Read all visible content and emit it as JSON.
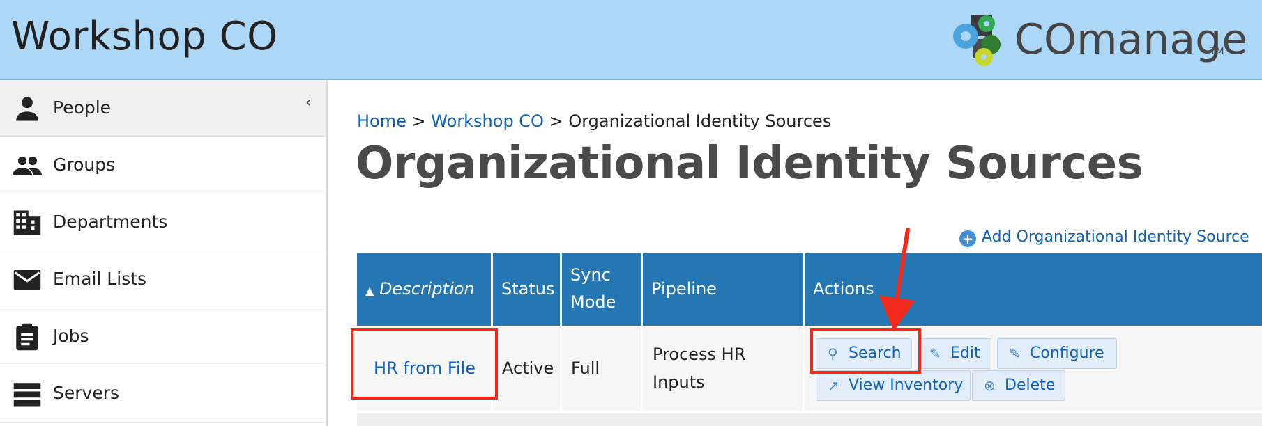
{
  "header": {
    "co_title": "Workshop CO",
    "logo_text": "COmanage",
    "logo_tm": "TM"
  },
  "sidebar": {
    "collapse_icon": "chevron-left-icon",
    "items": [
      {
        "label": "People",
        "icon": "person-icon",
        "active": true
      },
      {
        "label": "Groups",
        "icon": "group-icon"
      },
      {
        "label": "Departments",
        "icon": "building-icon"
      },
      {
        "label": "Email Lists",
        "icon": "email-icon"
      },
      {
        "label": "Jobs",
        "icon": "clipboard-icon"
      },
      {
        "label": "Servers",
        "icon": "servers-icon"
      }
    ]
  },
  "breadcrumb": {
    "home": "Home",
    "sep": ">",
    "co": "Workshop CO",
    "current": "Organizational Identity Sources"
  },
  "page": {
    "title": "Organizational Identity Sources",
    "add_link": "Add Organizational Identity Source"
  },
  "table": {
    "columns": {
      "sort_indicator": "▲",
      "description": "Description",
      "status": "Status",
      "sync_mode_line1": "Sync",
      "sync_mode_line2": "Mode",
      "pipeline": "Pipeline",
      "actions": "Actions"
    },
    "rows": [
      {
        "description": "HR from File",
        "status": "Active",
        "sync_mode": "Full",
        "pipeline_line1": "Process HR",
        "pipeline_line2": "Inputs",
        "actions": {
          "search": "Search",
          "edit": "Edit",
          "configure": "Configure",
          "view_inventory": "View Inventory",
          "delete": "Delete"
        }
      }
    ]
  },
  "colors": {
    "header_bg": "#add7f6",
    "table_header": "#2477b3",
    "link": "#0f62b8",
    "highlight": "#f22a1b"
  }
}
